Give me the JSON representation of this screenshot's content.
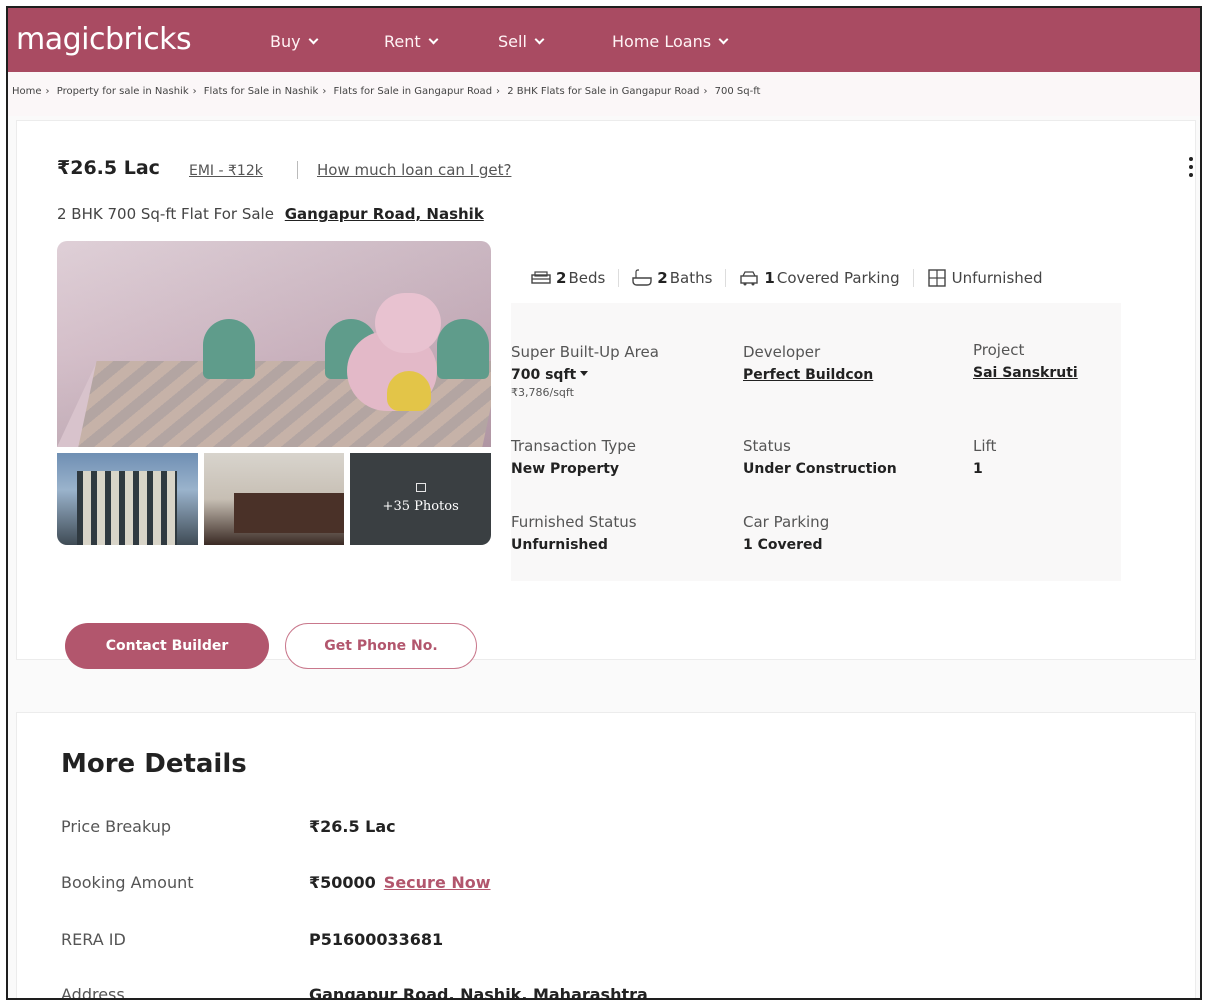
{
  "header": {
    "logo": "magicbricks",
    "nav": [
      {
        "label": "Buy"
      },
      {
        "label": "Rent"
      },
      {
        "label": "Sell"
      },
      {
        "label": "Home Loans"
      }
    ]
  },
  "breadcrumb": [
    "Home",
    "Property for sale in Nashik",
    "Flats for Sale in Nashik",
    "Flats for Sale in Gangapur Road",
    "2 BHK Flats for Sale in Gangapur Road",
    "700 Sq-ft"
  ],
  "listing": {
    "price": "₹26.5 Lac",
    "emi": "EMI - ₹12k",
    "loan_link": "How much loan can I get?",
    "subtitle": "2 BHK 700 Sq-ft Flat For Sale",
    "location": "Gangapur Road, Nashik",
    "photos_label": "+35 Photos",
    "amenities": {
      "beds_count": "2",
      "beds_label": "Beds",
      "baths_count": "2",
      "baths_label": "Baths",
      "parking_count": "1",
      "parking_label": "Covered Parking",
      "furnish_label": "Unfurnished"
    },
    "fields": {
      "area_label": "Super Built-Up Area",
      "area_value": "700 sqft",
      "area_rate": "₹3,786/sqft",
      "developer_label": "Developer",
      "developer_value": "Perfect Buildcon",
      "project_label": "Project",
      "project_value": "Sai Sanskruti",
      "transaction_label": "Transaction Type",
      "transaction_value": "New Property",
      "status_label": "Status",
      "status_value": "Under Construction",
      "lift_label": "Lift",
      "lift_value": "1",
      "furnished_label": "Furnished Status",
      "furnished_value": "Unfurnished",
      "car_label": "Car Parking",
      "car_value": "1 Covered"
    },
    "actions": {
      "contact": "Contact Builder",
      "phone": "Get Phone No."
    }
  },
  "more_details": {
    "title": "More Details",
    "price_label": "Price Breakup",
    "price_value": "₹26.5 Lac",
    "booking_label": "Booking Amount",
    "booking_value": "₹50000",
    "booking_link": "Secure Now",
    "rera_label": "RERA ID",
    "rera_value": "P51600033681",
    "address_label": "Address",
    "address_value": "Gangapur Road, Nashik, Maharashtra"
  }
}
